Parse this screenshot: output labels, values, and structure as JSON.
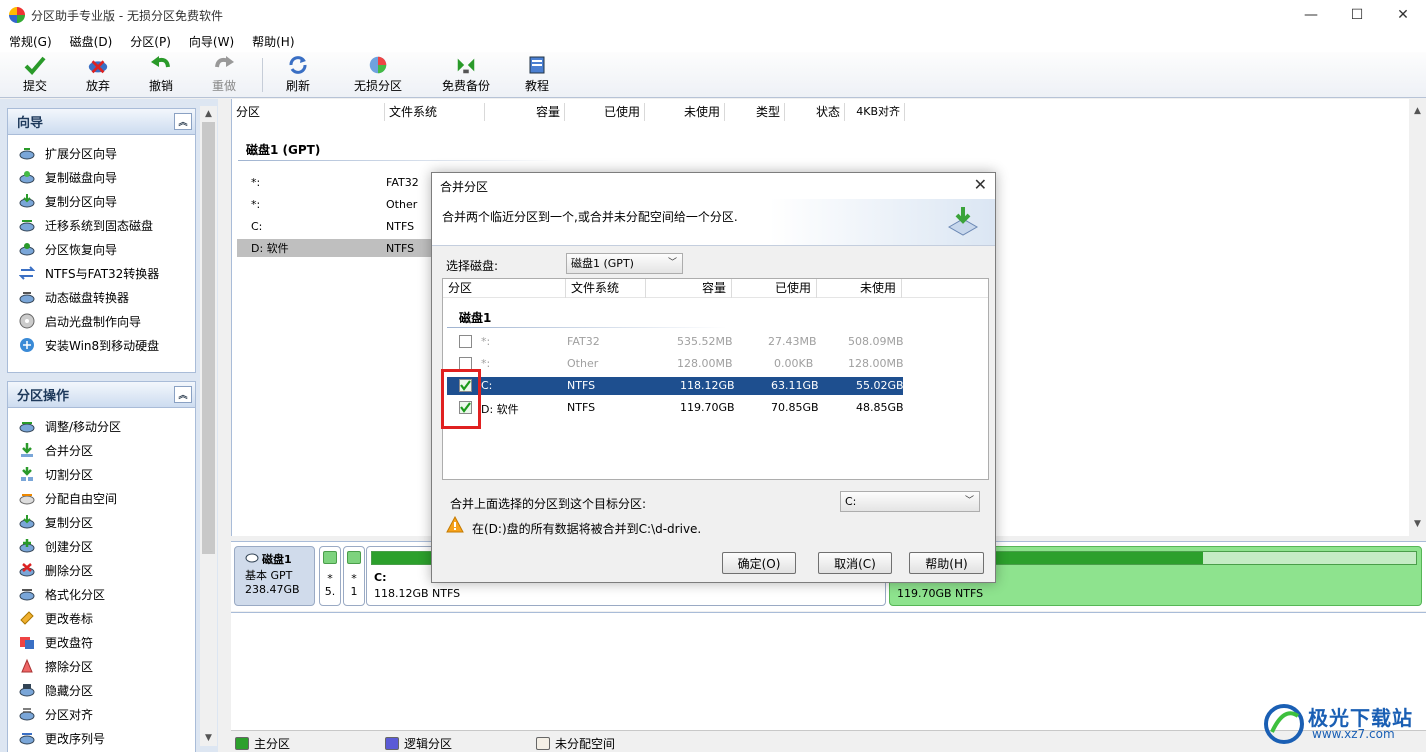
{
  "window": {
    "title": "分区助手专业版 - 无损分区免费软件",
    "minimize": "—",
    "maximize": "☐",
    "close": "✕"
  },
  "menu": [
    "常规(G)",
    "磁盘(D)",
    "分区(P)",
    "向导(W)",
    "帮助(H)"
  ],
  "toolbar": {
    "submit": "提交",
    "discard": "放弃",
    "undo": "撤销",
    "redo": "重做",
    "refresh": "刷新",
    "lossless": "无损分区",
    "backup": "免费备份",
    "tutorial": "教程"
  },
  "wizard": {
    "title": "向导",
    "collapse": "︽",
    "items": [
      "扩展分区向导",
      "复制磁盘向导",
      "复制分区向导",
      "迁移系统到固态磁盘",
      "分区恢复向导",
      "NTFS与FAT32转换器",
      "动态磁盘转换器",
      "启动光盘制作向导",
      "安装Win8到移动硬盘"
    ]
  },
  "ops": {
    "title": "分区操作",
    "collapse": "︽",
    "items": [
      "调整/移动分区",
      "合并分区",
      "切割分区",
      "分配自由空间",
      "复制分区",
      "创建分区",
      "删除分区",
      "格式化分区",
      "更改卷标",
      "更改盘符",
      "擦除分区",
      "隐藏分区",
      "分区对齐",
      "更改序列号"
    ]
  },
  "main": {
    "columns": [
      "分区",
      "文件系统",
      "容量",
      "已使用",
      "未使用",
      "类型",
      "状态",
      "4KB对齐"
    ],
    "disk_label": "磁盘1 (GPT)",
    "rows": [
      {
        "part": "*:",
        "fs": "FAT32"
      },
      {
        "part": "*:",
        "fs": "Other"
      },
      {
        "part": "C:",
        "fs": "NTFS"
      },
      {
        "part": "D: 软件",
        "fs": "NTFS"
      }
    ]
  },
  "diskmap": {
    "disk_name": "磁盘1",
    "disk_type": "基本 GPT",
    "disk_size": "238.47GB",
    "small1_label": "*",
    "small1_sub": "5.",
    "small2_label": "*",
    "small2_sub": "1",
    "c_name": "C:",
    "c_size": "118.12GB NTFS",
    "c_used": 0.534,
    "d_size": "119.70GB NTFS",
    "d_used": 0.592
  },
  "legend": {
    "primary": "主分区",
    "logical": "逻辑分区",
    "unallocated": "未分配空间"
  },
  "dialog": {
    "title": "合并分区",
    "close": "✕",
    "description": "合并两个临近分区到一个,或合并未分配空间给一个分区.",
    "select_disk_label": "选择磁盘:",
    "select_disk_value": "磁盘1 (GPT)",
    "columns": [
      "分区",
      "文件系统",
      "容量",
      "已使用",
      "未使用"
    ],
    "disk_label": "磁盘1",
    "rows": [
      {
        "part": "*:",
        "fs": "FAT32",
        "cap": "535.52MB",
        "used": "27.43MB",
        "free": "508.09MB",
        "checked": false
      },
      {
        "part": "*:",
        "fs": "Other",
        "cap": "128.00MB",
        "used": "0.00KB",
        "free": "128.00MB",
        "checked": false
      },
      {
        "part": "C:",
        "fs": "NTFS",
        "cap": "118.12GB",
        "used": "63.11GB",
        "free": "55.02GB",
        "checked": true
      },
      {
        "part": "D:  软件",
        "fs": "NTFS",
        "cap": "119.70GB",
        "used": "70.85GB",
        "free": "48.85GB",
        "checked": true
      }
    ],
    "target_label": "合并上面选择的分区到这个目标分区:",
    "target_value": "C:",
    "warning": "在(D:)盘的所有数据将被合并到C:\\d-drive.",
    "ok": "确定(O)",
    "cancel": "取消(C)",
    "help": "帮助(H)"
  },
  "watermark": {
    "text": "极光下载站",
    "url": "www.xz7.com"
  },
  "colors": {
    "accent": "#1e4f8f",
    "primary_partition": "#2ca02c",
    "logical_partition": "#5b5bd6",
    "highlight": "#e02020"
  }
}
